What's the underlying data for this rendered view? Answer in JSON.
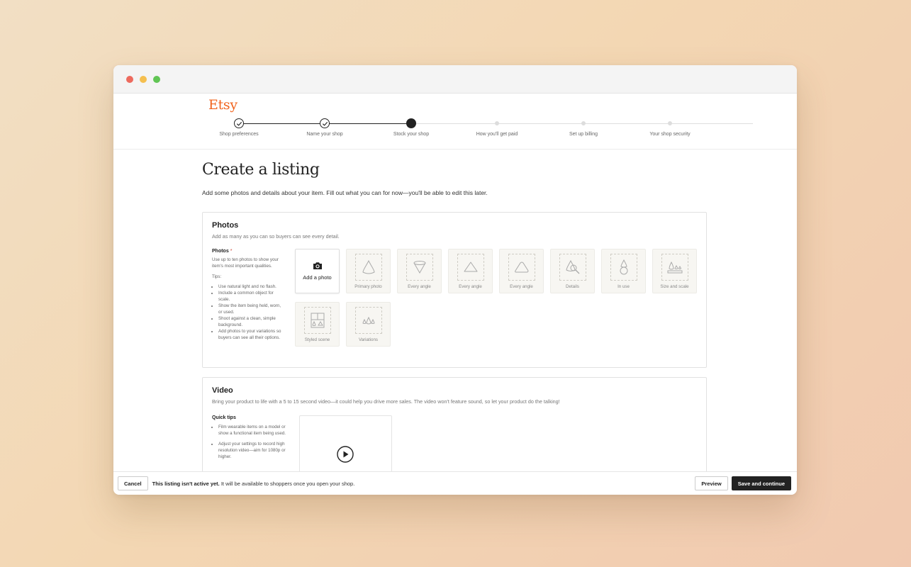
{
  "brand": {
    "logo": "Etsy",
    "color": "#f1641e"
  },
  "steps": [
    {
      "label": "Shop preferences",
      "state": "done"
    },
    {
      "label": "Name your shop",
      "state": "done"
    },
    {
      "label": "Stock your shop",
      "state": "current"
    },
    {
      "label": "How you'll get paid",
      "state": "pending"
    },
    {
      "label": "Set up billing",
      "state": "pending"
    },
    {
      "label": "Your shop security",
      "state": "pending"
    }
  ],
  "page": {
    "title": "Create a listing",
    "subtitle": "Add some photos and details about your item. Fill out what you can for now—you'll be able to edit this later."
  },
  "photos": {
    "title": "Photos",
    "subtitle": "Add as many as you can so buyers can see every detail.",
    "help_title": "Photos",
    "required_mark": "*",
    "help_text": "Use up to ten photos to show your item's most important qualities.",
    "tips_title": "Tips:",
    "tips": [
      "Use natural light and no flash.",
      "Include a common object for scale.",
      "Show the item being held, worn, or used.",
      "Shoot against a clean, simple background.",
      "Add photos to your variations so buyers can see all their options."
    ],
    "add_label": "Add a photo",
    "tiles": [
      {
        "label": "Primary photo",
        "icon": "cone-icon"
      },
      {
        "label": "Every angle",
        "icon": "inverted-cone-icon"
      },
      {
        "label": "Every angle",
        "icon": "triangle-icon"
      },
      {
        "label": "Every angle",
        "icon": "rounded-triangle-icon"
      },
      {
        "label": "Details",
        "icon": "magnifier-icon"
      },
      {
        "label": "In use",
        "icon": "person-icon"
      },
      {
        "label": "Size and scale",
        "icon": "ruler-icon"
      },
      {
        "label": "Styled scene",
        "icon": "scene-icon"
      },
      {
        "label": "Variations",
        "icon": "variations-icon"
      }
    ]
  },
  "video": {
    "title": "Video",
    "subtitle": "Bring your product to life with a 5 to 15 second video—it could help you drive more sales. The video won't feature sound, so let your product do the talking!",
    "tips_title": "Quick tips",
    "tips": [
      "Film wearable items on a model or show a functional item being used.",
      "Adjust your settings to record high resolution video—aim for 1080p or higher."
    ]
  },
  "footer": {
    "cancel": "Cancel",
    "status_bold": "This listing isn't active yet.",
    "status_rest": " It will be available to shoppers once you open your shop.",
    "preview": "Preview",
    "save": "Save and continue"
  }
}
